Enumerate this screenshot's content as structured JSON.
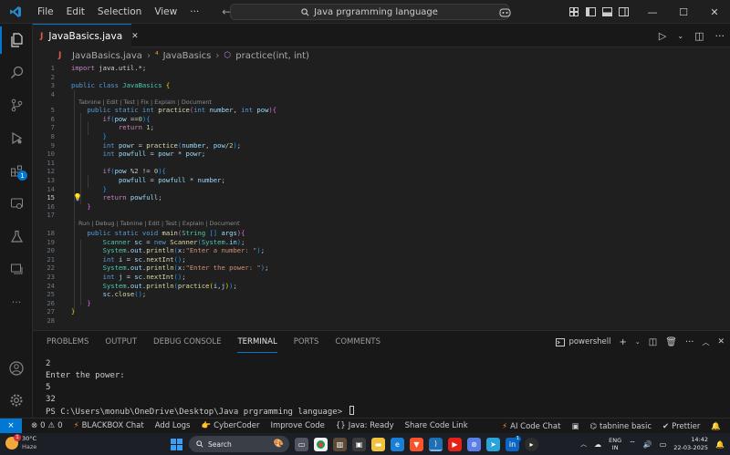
{
  "titlebar": {
    "menu": [
      "File",
      "Edit",
      "Selection",
      "View",
      "···"
    ],
    "search_text": "Java prgramming language"
  },
  "tab": {
    "label": "JavaBasics.java"
  },
  "breadcrumb": {
    "file": "JavaBasics.java",
    "class": "JavaBasics",
    "method": "practice(int, int)"
  },
  "editor": {
    "code_lens_1": "Tabnine | Edit | Test | Fix | Explain | Document",
    "code_lens_2": "Run | Debug | Tabnine | Edit | Test | Explain | Document",
    "current_line": 15,
    "lines": [
      "import java.util.*;",
      "",
      "public class JavaBasics {",
      "",
      "    public static int practice(int number, int pow){",
      "        if(pow ==0){",
      "            return 1;",
      "        }",
      "        int powr = practice(number, pow/2);",
      "        int powfull = powr * powr;",
      "",
      "        if(pow %2 != 0){",
      "            powfull = powfull * number;",
      "        }",
      "        return powfull;",
      "    }",
      "",
      "    public static void main(String [] args){",
      "        Scanner sc = new Scanner(System.in);",
      "        System.out.println(x:\"Enter a number: \");",
      "        int i = sc.nextInt();",
      "        System.out.println(x:\"Enter the power: \");",
      "        int j = sc.nextInt();",
      "        System.out.println(practice(i,j));",
      "        sc.close();",
      "    }",
      "}",
      ""
    ]
  },
  "panel": {
    "tabs": [
      "PROBLEMS",
      "OUTPUT",
      "DEBUG CONSOLE",
      "TERMINAL",
      "PORTS",
      "COMMENTS"
    ],
    "active_tab": "TERMINAL",
    "shell": "powershell",
    "terminal_lines": [
      "2",
      "Enter the power:",
      "5",
      "32"
    ],
    "prompt": "PS C:\\Users\\monub\\OneDrive\\Desktop\\Java prgramming language> "
  },
  "statusbar": {
    "errors": "0",
    "warnings": "0",
    "blackbox": "BLACKBOX Chat",
    "add_logs": "Add Logs",
    "cybercoder": "CyberCoder",
    "improve_code": "Improve Code",
    "java_status": "Java: Ready",
    "share_code": "Share Code Link",
    "ai_chat": "AI Code Chat",
    "tabnine": "tabnine basic",
    "prettier": "Prettier"
  },
  "taskbar": {
    "weather_temp": "30°C",
    "weather_desc": "Haze",
    "weather_badge": "1",
    "search_label": "Search",
    "lang_top": "ENG",
    "lang_bottom": "IN",
    "time": "14:42",
    "date": "22-03-2025",
    "linkedin_badge": "1"
  },
  "activity": {
    "extensions_badge": "1"
  },
  "colors": {
    "accent": "#0078d4",
    "editor_bg": "#1f1f1f",
    "sidebar_bg": "#181818"
  }
}
